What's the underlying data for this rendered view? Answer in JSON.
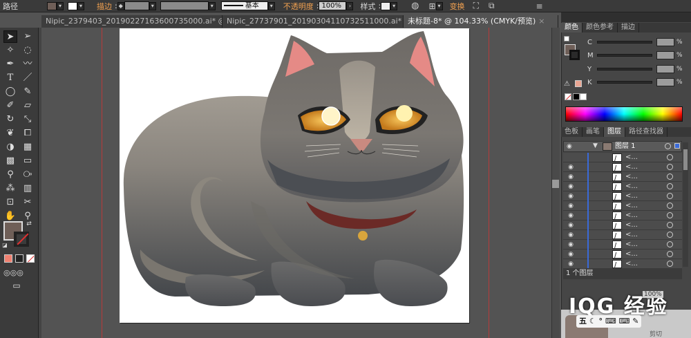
{
  "control_bar": {
    "object_type": "路径",
    "stroke_label": "描边",
    "stroke_profile": "基本",
    "opacity_label": "不透明度",
    "opacity_value": "100%",
    "style_label": "样式",
    "transform_label": "变换"
  },
  "tabs": [
    {
      "label": "Nipic_2379403_20190227163600735000.ai* @ 180...",
      "close": "×"
    },
    {
      "label": "Nipic_27737901_20190304110732511000.ai* @ 158...",
      "close": "×"
    },
    {
      "label": "未标题-8* @ 104.33% (CMYK/预览)",
      "close": "×",
      "active": true
    }
  ],
  "color_panel": {
    "tabs": [
      "颜色",
      "颜色参考",
      "描边"
    ],
    "active_tab": "颜色",
    "channels": [
      {
        "name": "C",
        "unit": "%"
      },
      {
        "name": "M",
        "unit": "%"
      },
      {
        "name": "Y",
        "unit": "%"
      },
      {
        "name": "K",
        "unit": "%"
      }
    ],
    "fill_color": "#6f5f58"
  },
  "layers_panel": {
    "tabs": [
      "色板",
      "画笔",
      "图层",
      "路径查找器"
    ],
    "active_tab": "图层",
    "layer_name": "图层 1",
    "sublayer_name": "<...",
    "sublayer_count": 12,
    "footer_text": "1 个图层"
  },
  "artboard": {
    "bg": "#ffffff"
  },
  "watermark": {
    "text": "IQG 经验",
    "sub": "100%",
    "strip": "五 ☾ ° ⌨ ⌨ ✎",
    "extra": "剪切"
  }
}
